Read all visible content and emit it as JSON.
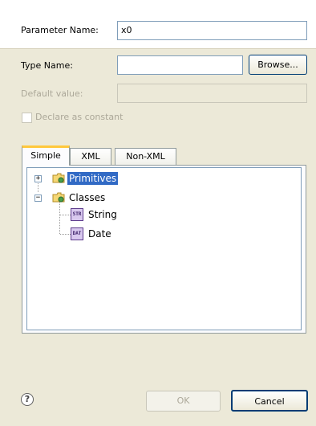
{
  "form": {
    "parameter_name_label": "Parameter Name:",
    "parameter_name_value": "x0",
    "type_name_label": "Type Name:",
    "type_name_value": "",
    "browse_label": "Browse...",
    "default_value_label": "Default value:",
    "default_value_value": "",
    "declare_constant_label": "Declare as constant",
    "declare_constant_checked": false
  },
  "tabs": [
    {
      "label": "Simple",
      "active": true
    },
    {
      "label": "XML",
      "active": false
    },
    {
      "label": "Non-XML",
      "active": false
    }
  ],
  "tree": {
    "nodes": [
      {
        "label": "Primitives",
        "expander": "+",
        "selected": true
      },
      {
        "label": "Classes",
        "expander": "−",
        "selected": false
      },
      {
        "label": "String",
        "icon_text": "STR"
      },
      {
        "label": "Date",
        "icon_text": "DAT"
      }
    ]
  },
  "footer": {
    "help_glyph": "?",
    "ok_label": "OK",
    "cancel_label": "Cancel"
  },
  "colors": {
    "selection": "#316ac5",
    "active_tab_accent": "#ffc83c",
    "dialog_bg": "#ece9d8"
  }
}
